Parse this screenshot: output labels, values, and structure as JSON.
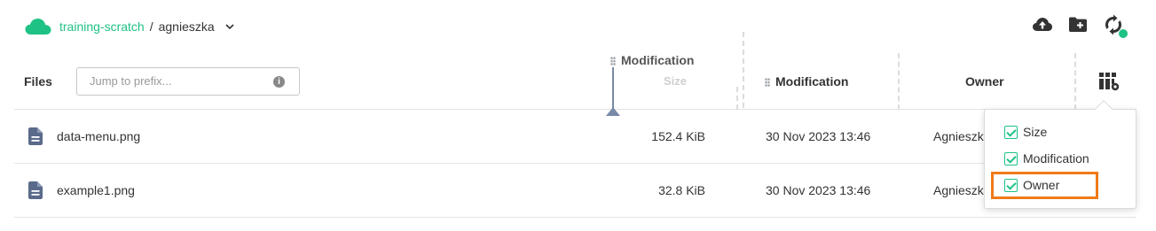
{
  "breadcrumb": {
    "bucket": "training-scratch",
    "separator": "/",
    "prefix": "agnieszka"
  },
  "toolbar": {
    "upload_icon": "cloud-upload-icon",
    "new_folder_icon": "folder-plus-icon",
    "sync_icon": "sync-icon",
    "sync_status_color": "#1fc285"
  },
  "table_header": {
    "files_label": "Files",
    "search_placeholder": "Jump to prefix...",
    "dragged_column": {
      "label": "Modification",
      "sub_label": "Size"
    },
    "columns": {
      "modification": "Modification",
      "owner": "Owner"
    }
  },
  "files": [
    {
      "name": "data-menu.png",
      "size": "152.4 KiB",
      "modified": "30 Nov 2023 13:46",
      "owner": "Agnieszk"
    },
    {
      "name": "example1.png",
      "size": "32.8 KiB",
      "modified": "30 Nov 2023 13:46",
      "owner": "Agnieszk"
    }
  ],
  "column_menu": {
    "options": [
      {
        "label": "Size",
        "checked": true
      },
      {
        "label": "Modification",
        "checked": true
      },
      {
        "label": "Owner",
        "checked": true
      }
    ]
  },
  "colors": {
    "accent": "#1fc285",
    "highlight": "#f07a1a"
  }
}
